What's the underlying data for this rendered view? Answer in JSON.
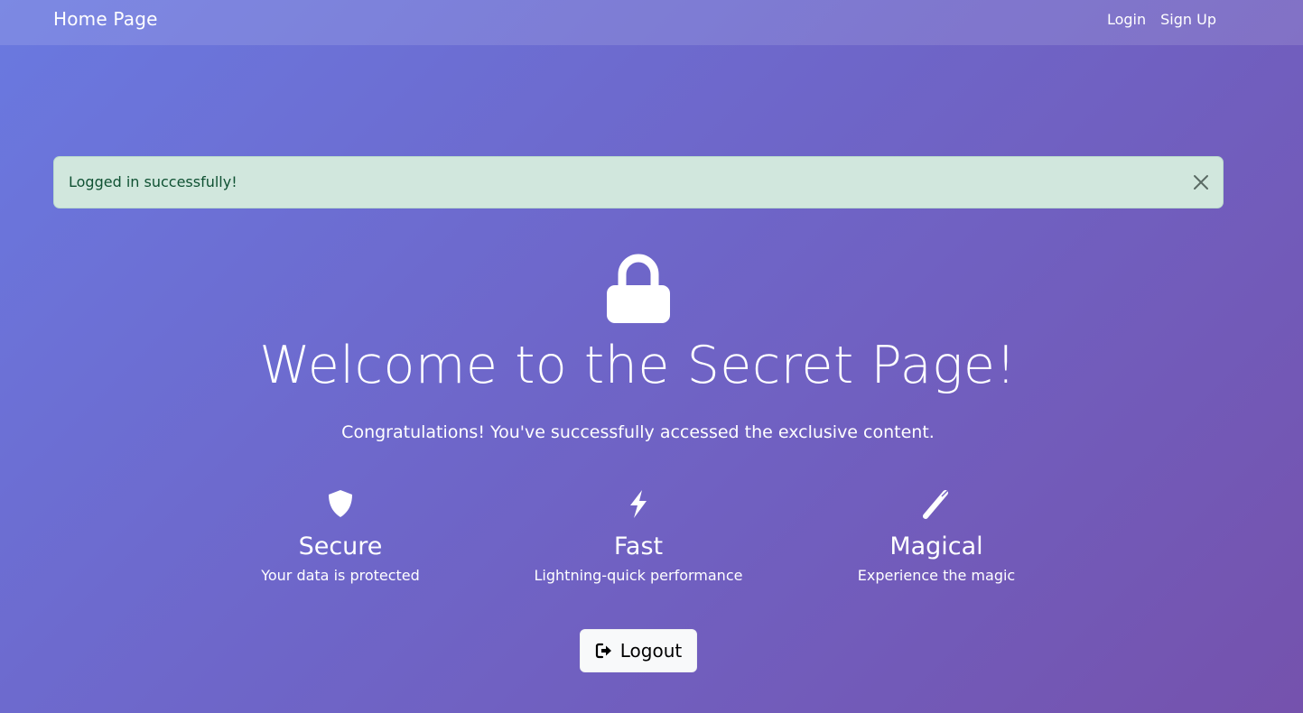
{
  "navbar": {
    "brand": "Home Page",
    "links": [
      {
        "label": "Login"
      },
      {
        "label": "Sign Up"
      }
    ]
  },
  "alert": {
    "message": "Logged in successfully!",
    "close_icon": "close-icon",
    "colors": {
      "background": "#d1e7dd",
      "text": "#0f5132"
    }
  },
  "hero": {
    "icon": "lock-icon",
    "title": "Welcome to the Secret Page!",
    "subtitle": "Congratulations! You've successfully accessed the exclusive content."
  },
  "features": [
    {
      "icon": "shield-icon",
      "title": "Secure",
      "description": "Your data is protected"
    },
    {
      "icon": "lightning-icon",
      "title": "Fast",
      "description": "Lightning-quick performance"
    },
    {
      "icon": "magic-wand-icon",
      "title": "Magical",
      "description": "Experience the magic"
    }
  ],
  "logout": {
    "label": "Logout",
    "icon": "logout-icon"
  },
  "colors": {
    "gradient_start": "#6a79e0",
    "gradient_end": "#7552ad"
  }
}
